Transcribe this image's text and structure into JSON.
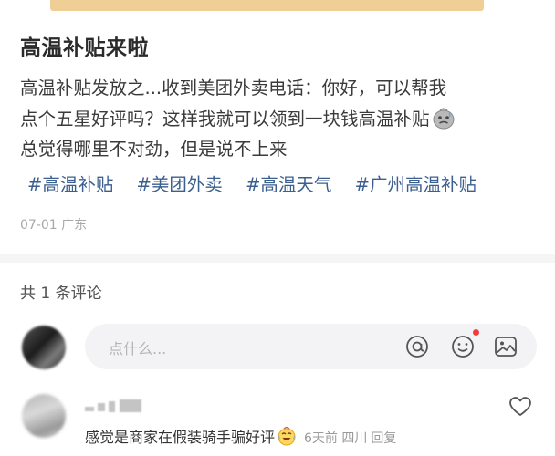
{
  "post": {
    "title": "高温补贴来啦",
    "body_lines": [
      "高温补贴发放之...收到美团外卖电话：你好，可以帮我",
      "点个五星好评吗？这样我就可以领到一块钱高温补贴",
      "总觉得哪里不对劲，但是说不上来"
    ],
    "inline_emoji": "worried-emoji-icon",
    "hashtags": [
      "#高温补贴",
      "#美团外卖",
      "#高温天气",
      "#广州高温补贴"
    ],
    "meta": "07-01 广东"
  },
  "comments_header": {
    "count_label": "共 1 条评论"
  },
  "comment_input": {
    "placeholder": "点什么...",
    "icons": [
      "at-icon",
      "smile-icon",
      "image-icon"
    ],
    "notification_color": "#f23b3b"
  },
  "comments": [
    {
      "text": "感觉是商家在假装骑手骗好评",
      "emoji": "laugh-cry-emoji-icon",
      "meta": "6天前 四川",
      "reply_label": "回复"
    }
  ],
  "colors": {
    "hashtag": "#3b5f8f",
    "meta": "#a8a8a8",
    "input_bg": "#f3f3f5"
  }
}
